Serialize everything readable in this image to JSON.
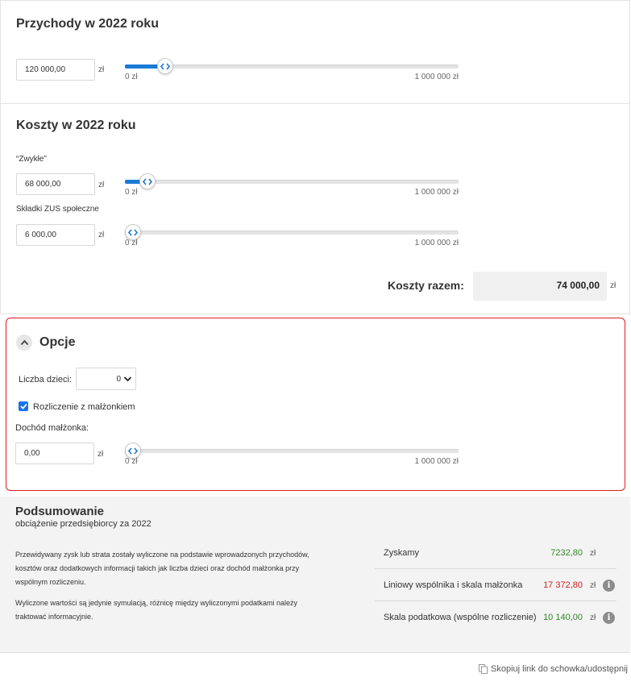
{
  "income": {
    "title": "Przychody w 2022 roku",
    "value": "120 000,00",
    "unit": "zł",
    "slider": {
      "min_label": "0 zł",
      "max_label": "1 000 000 zł",
      "fraction": 0.12
    }
  },
  "costs": {
    "title": "Koszty w 2022 roku",
    "regular": {
      "label": "“Zwykłe”",
      "value": "68 000,00",
      "unit": "zł",
      "slider": {
        "min_label": "0 zł",
        "max_label": "1 000 000 zł",
        "fraction": 0.068
      }
    },
    "zus": {
      "label": "Składki ZUS społeczne",
      "value": "6 000,00",
      "unit": "zł",
      "slider": {
        "min_label": "0 zł",
        "max_label": "1 000 000 zł",
        "fraction": 0.006
      }
    },
    "total_label": "Koszty razem:",
    "total_value": "74 000,00",
    "total_unit": "zł"
  },
  "options": {
    "title": "Opcje",
    "toggle_icon": "chevron-up-icon",
    "children_label": "Liczba dzieci:",
    "children_value": "0",
    "joint_label": "Rozliczenie z małżonkiem",
    "joint_checked": true,
    "spouse_income_label": "Dochód małżonka:",
    "spouse_income_value": "0,00",
    "spouse_income_unit": "zł",
    "slider": {
      "min_label": "0 zł",
      "max_label": "1 000 000 zł",
      "fraction": 0.0
    }
  },
  "summary": {
    "title": "Podsumowanie",
    "subtitle": "obciążenie przedsiębiorcy za 2022",
    "paragraph1": "Przewidywany zysk lub strata zostały wyliczone na podstawie wprowadzonych przychodów, kosztów oraz dodatkowych informacji takich jak liczba dzieci oraz dochód małżonka przy wspólnym rozliczeniu.",
    "paragraph2": "Wyliczone wartości są jedynie symulacją, różnicę między wyliczonymi podatkami należy traktować informacyjnie.",
    "results": [
      {
        "label": "Zyskamy",
        "value": "7232,80",
        "unit": "zł",
        "color": "#2e8a1f",
        "info": false
      },
      {
        "label": "Liniowy wspólnika i skala małżonka",
        "value": "17 372,80",
        "unit": "zł",
        "color": "#cc1e1e",
        "info": true
      },
      {
        "label": "Skala podatkowa (wspólne rozliczenie)",
        "value": "10 140,00",
        "unit": "zł",
        "color": "#2e8a1f",
        "info": true
      }
    ]
  },
  "footer": {
    "copy_link": "Skopiuj link do schowka/udostępnij",
    "copy_icon": "copy-icon"
  },
  "colors": {
    "accent": "#1a7ad4",
    "highlight_border": "#e01a1a",
    "positive": "#2e8a1f",
    "negative": "#cc1e1e"
  }
}
